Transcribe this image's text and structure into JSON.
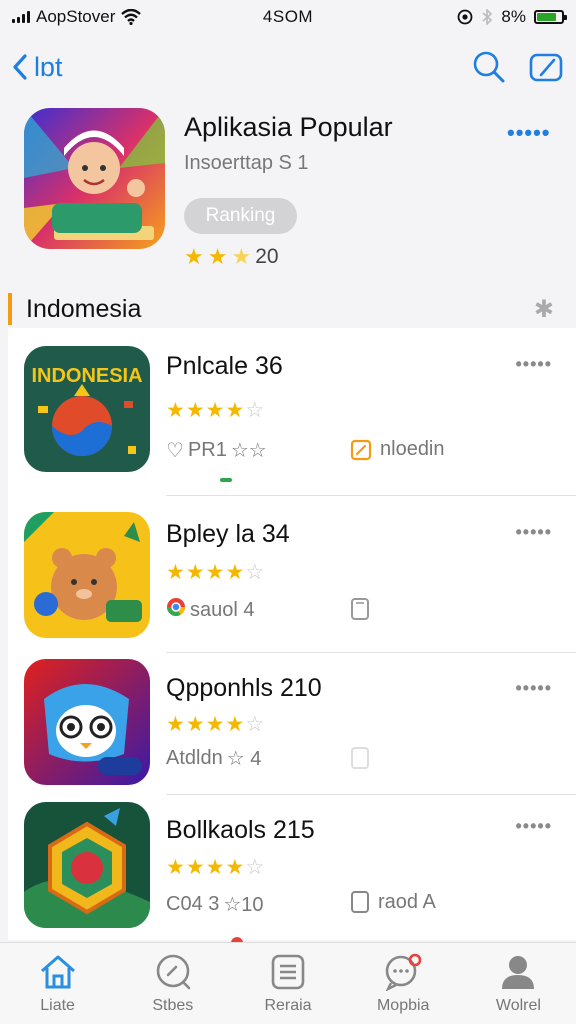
{
  "status": {
    "carrier": "AopStover",
    "time": "4SOM",
    "battery": "8%"
  },
  "nav": {
    "back_label": "lɒt"
  },
  "header_app": {
    "title": "Aplikasia Popular",
    "subtitle": "Insoerttap S 1",
    "pill": "Ranking",
    "rating_count": "20",
    "rating": 2.5
  },
  "section": {
    "title": "Indomesia"
  },
  "apps": [
    {
      "title": "Pnlcale 36",
      "rating": 4.5,
      "meta": "PR1",
      "meta_stars": "☆☆",
      "side": "nloedin",
      "icon_text": "INDONESIA"
    },
    {
      "title": "Bpley la 34",
      "rating": 4.5,
      "meta": "sauol 4",
      "meta_stars": "",
      "side": "",
      "icon_text": ""
    },
    {
      "title": "Qpponhls 210",
      "rating": 4.5,
      "meta": "Atdldn",
      "meta_stars": "☆ 4",
      "side": "",
      "icon_text": ""
    },
    {
      "title": "Bollkaols 215",
      "rating": 4.5,
      "meta": "C04 3",
      "meta_stars": "☆10",
      "side": "raod A",
      "icon_text": ""
    }
  ],
  "tabs": [
    {
      "label": "Liate",
      "icon": "home-icon"
    },
    {
      "label": "Stbes",
      "icon": "search-icon"
    },
    {
      "label": "Reraia",
      "icon": "list-icon"
    },
    {
      "label": "Mopbia",
      "icon": "chat-search-icon"
    },
    {
      "label": "Wolrel",
      "icon": "person-icon"
    }
  ],
  "colors": {
    "accent": "#1e7fe0",
    "star": "#f5b800",
    "section_bar": "#f39c12",
    "badge_red": "#e8413a"
  }
}
